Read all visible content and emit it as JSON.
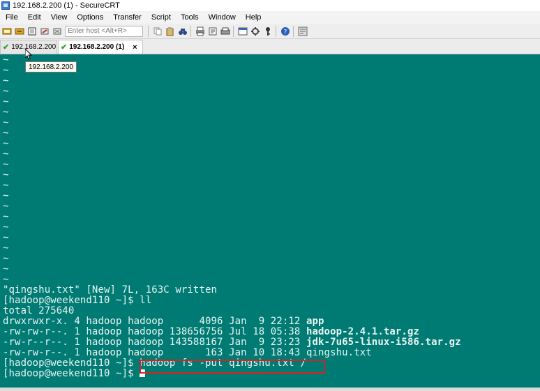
{
  "window": {
    "title": "192.168.2.200 (1) - SecureCRT"
  },
  "menu": [
    "File",
    "Edit",
    "View",
    "Options",
    "Transfer",
    "Script",
    "Tools",
    "Window",
    "Help"
  ],
  "toolbar": {
    "host_placeholder": "Enter host <Alt+R>"
  },
  "tabs": [
    {
      "label": "192.168.2.200",
      "active": false
    },
    {
      "label": "192.168.2.200 (1)",
      "active": true,
      "close": "×"
    }
  ],
  "tooltip": "192.168.2.200",
  "terminal": {
    "tilde": "~",
    "tilde_count": 22,
    "write_msg": "\"qingshu.txt\" [New] 7L, 163C written",
    "prompt": "[hadoop@weekend110 ~]$ ",
    "cmd_ll": "ll",
    "total": "total 275640",
    "listing": [
      {
        "meta": "drwxrwxr-x. 4 hadoop hadoop      4096 Jan  9 22:12 ",
        "name": "app",
        "bold": true
      },
      {
        "meta": "-rw-rw-r--. 1 hadoop hadoop 138656756 Jul 18 05:38 ",
        "name": "hadoop-2.4.1.tar.gz",
        "bold": true
      },
      {
        "meta": "-rw-r--r--. 1 hadoop hadoop 143588167 Jan  9 23:23 ",
        "name": "jdk-7u65-linux-i586.tar.gz",
        "bold": true
      },
      {
        "meta": "-rw-rw-r--. 1 hadoop hadoop       163 Jan 10 18:43 ",
        "name": "qingshu.txt",
        "bold": false
      }
    ],
    "cmd_put": "hadoop fs -put qingshu.txt /"
  },
  "colors": {
    "terminal_bg": "#007b74",
    "terminal_fg": "#e8f4f2",
    "highlight": "#e02020"
  }
}
